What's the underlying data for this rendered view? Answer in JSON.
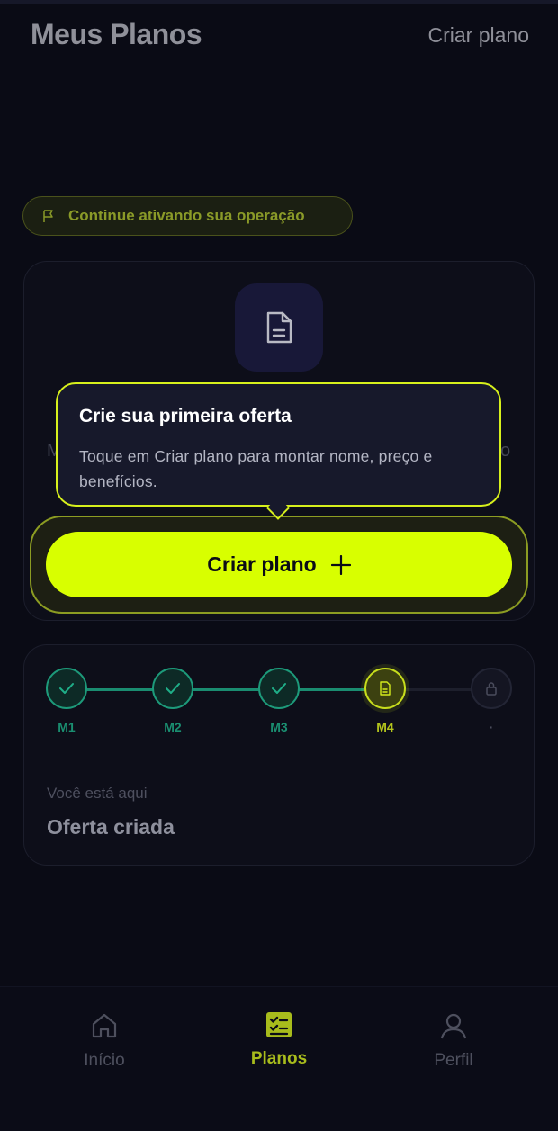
{
  "header": {
    "title": "Meus Planos",
    "action": "Criar plano"
  },
  "notice": {
    "text": "Continue ativando sua operação",
    "icon": "flag-icon"
  },
  "empty_state": {
    "icon": "document-icon",
    "ghost_left": "M",
    "ghost_right": "o"
  },
  "tooltip": {
    "title": "Crie sua primeira oferta",
    "body": "Toque em Criar plano para montar nome, preço e benefícios."
  },
  "cta": {
    "label": "Criar plano",
    "icon": "plus-icon"
  },
  "progress": {
    "steps": [
      {
        "label": "M1",
        "state": "done"
      },
      {
        "label": "M2",
        "state": "done"
      },
      {
        "label": "M3",
        "state": "done"
      },
      {
        "label": "M4",
        "state": "current"
      },
      {
        "label": "·",
        "state": "locked"
      }
    ],
    "here_label": "Você está aqui",
    "here_value": "Oferta criada"
  },
  "nav": {
    "items": [
      {
        "label": "Início",
        "icon": "home-icon",
        "active": false
      },
      {
        "label": "Planos",
        "icon": "checklist-icon",
        "active": true
      },
      {
        "label": "Perfil",
        "icon": "user-icon",
        "active": false
      }
    ]
  },
  "colors": {
    "accent": "#d8ff00",
    "background": "#0a0b15",
    "success": "#1d9a7a",
    "card": "#0d0e19"
  }
}
